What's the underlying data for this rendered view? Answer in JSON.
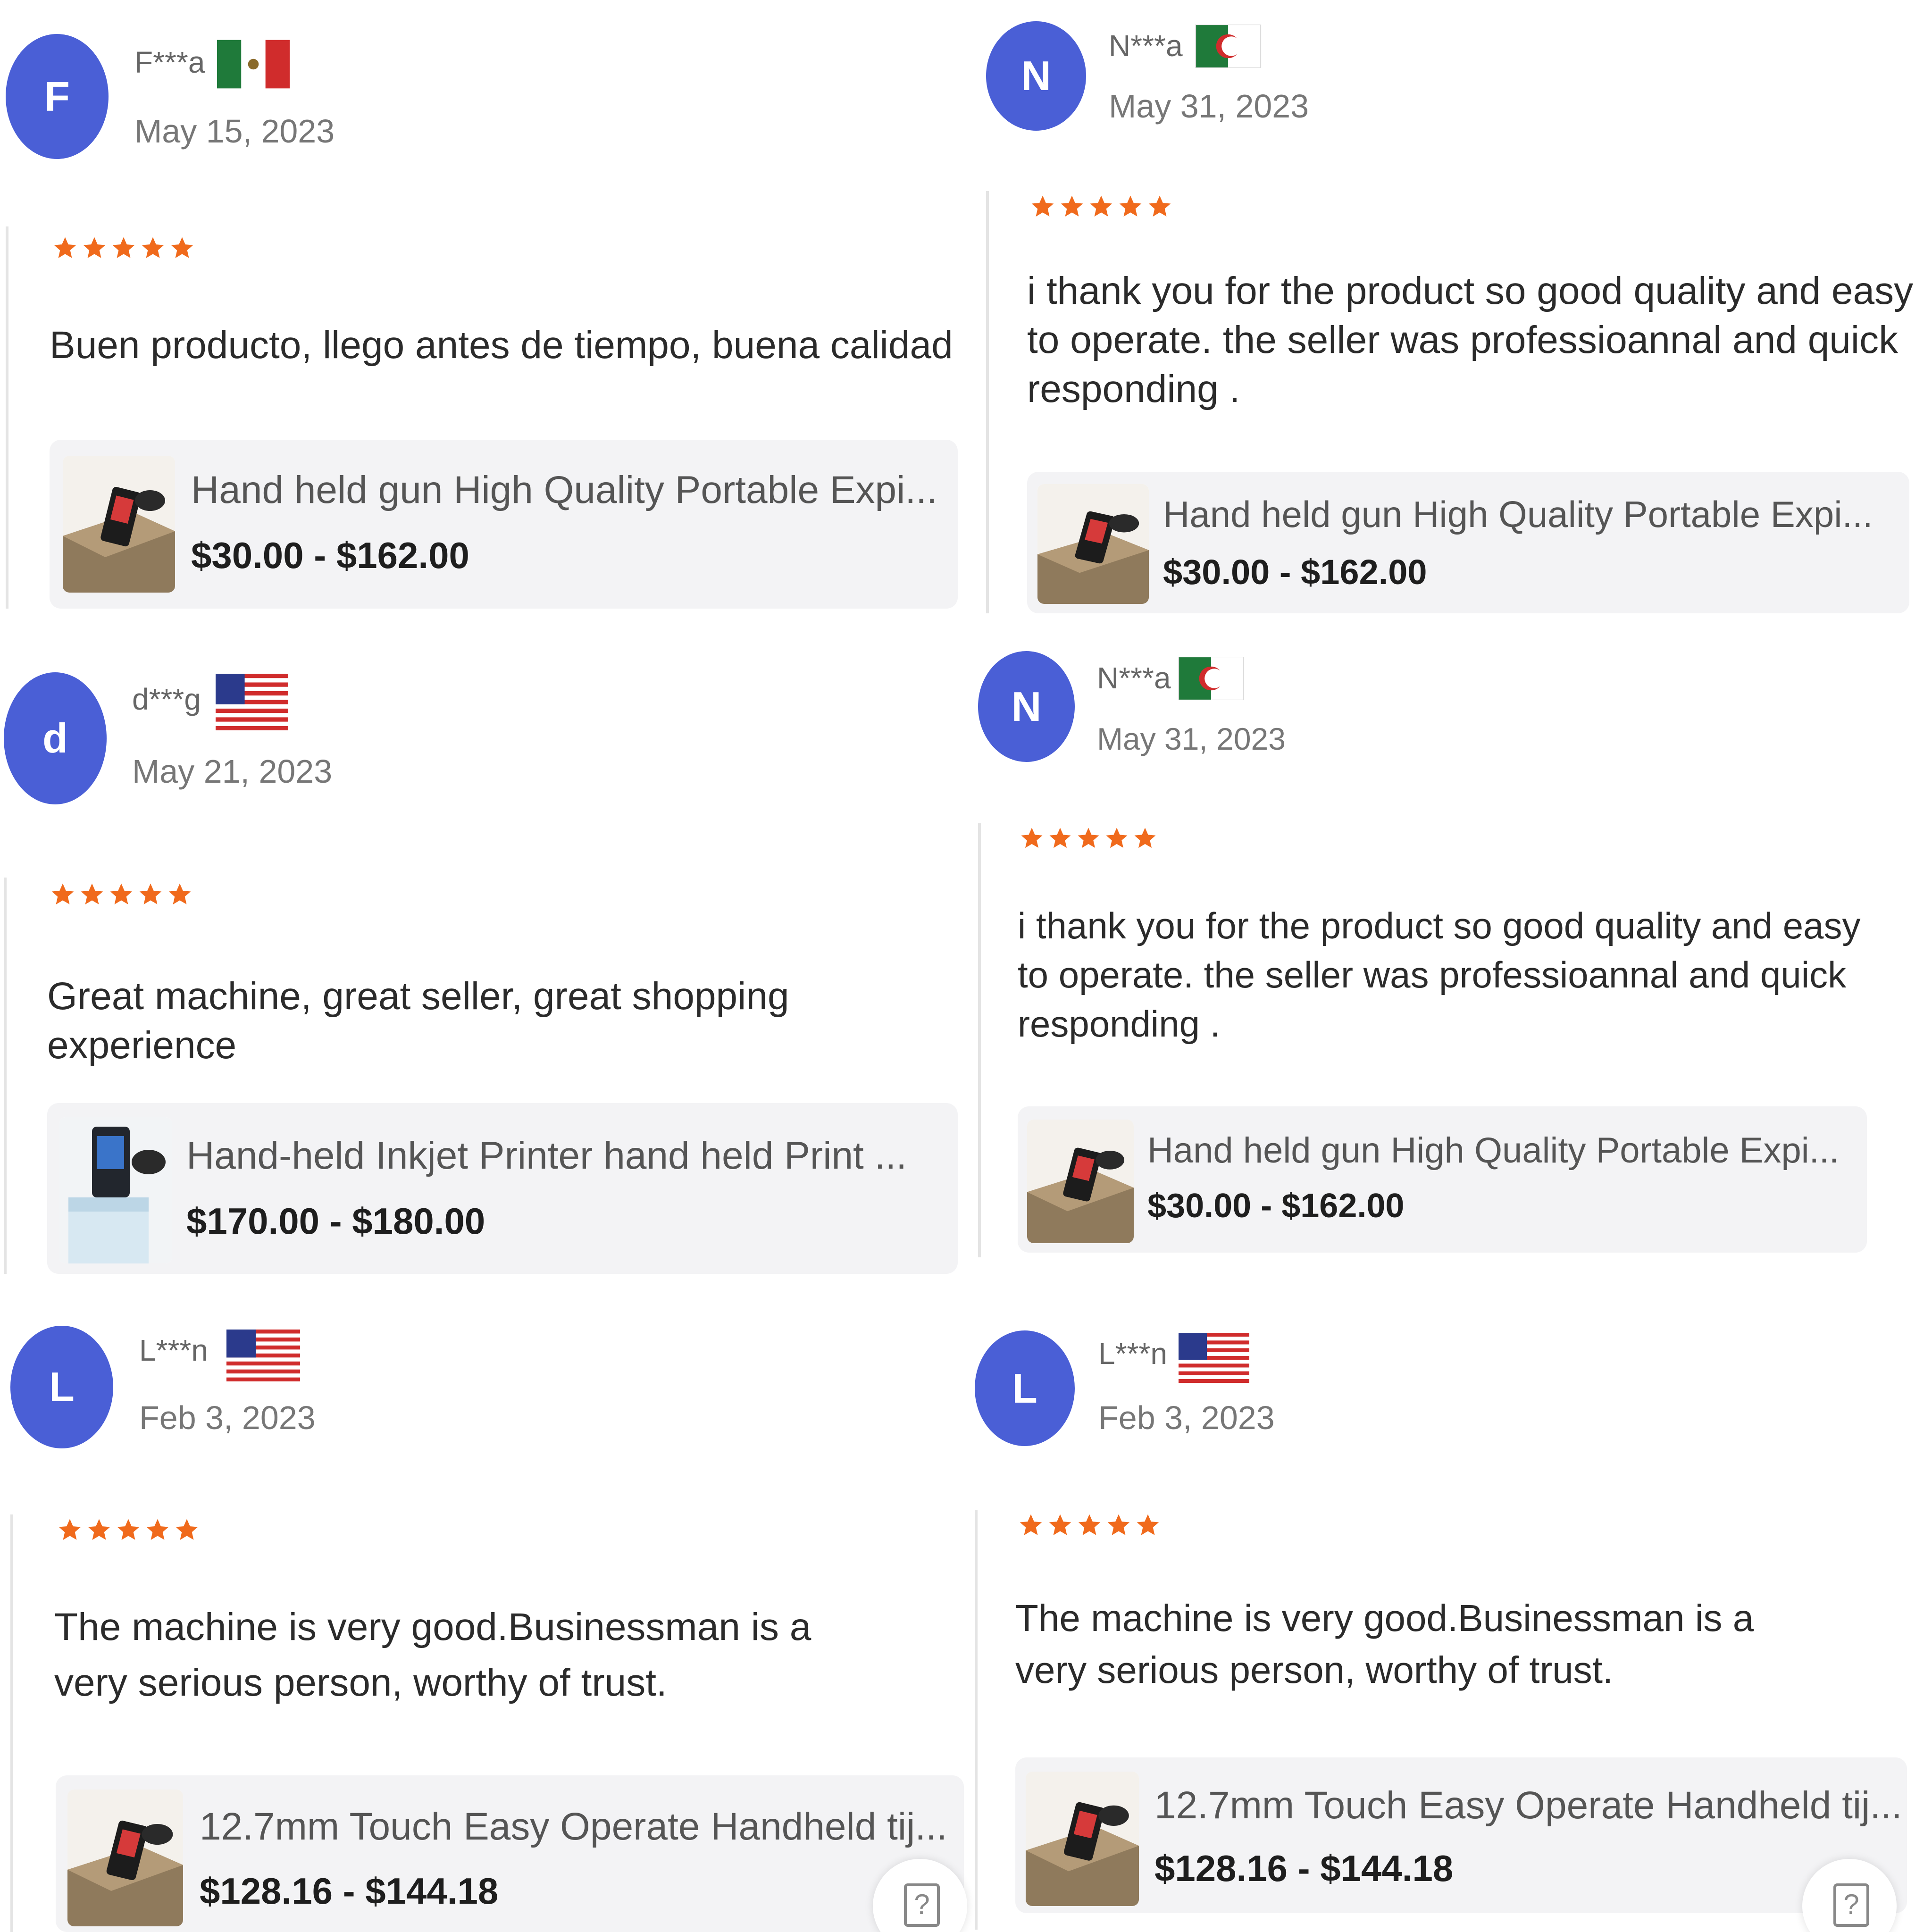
{
  "colors": {
    "avatar_bg": "#4a5fd6",
    "star": "#f06a1c",
    "card_bg": "#f3f3f5",
    "divider": "#e4e4e4"
  },
  "reviews": [
    {
      "avatar_letter": "F",
      "username": "F***a",
      "flag": "mexico-flag",
      "date": "May 15, 2023",
      "rating": 5,
      "text": "Buen producto, llego antes de tiempo, buena calidad",
      "product": {
        "title": "Hand held gun High Quality Portable Expi...",
        "price": "$30.00 - $162.00",
        "thumb": "handheld-printer-on-box-image"
      }
    },
    {
      "avatar_letter": "N",
      "username": "N***a",
      "flag": "algeria-flag",
      "date": "May 31, 2023",
      "rating": 5,
      "text": "i thank you for the product so good quality and easy to operate. the seller was professioannal and quick responding .",
      "product": {
        "title": "Hand held gun High Quality Portable Expi...",
        "price": "$30.00 - $162.00",
        "thumb": "handheld-printer-on-box-image"
      }
    },
    {
      "avatar_letter": "d",
      "username": "d***g",
      "flag": "usa-flag",
      "date": "May 21, 2023",
      "rating": 5,
      "text": "Great machine, great seller, great shopping experience",
      "product": {
        "title": "Hand-held Inkjet Printer hand held Print ...",
        "price": "$170.00 - $180.00",
        "thumb": "inkjet-printer-image"
      }
    },
    {
      "avatar_letter": "N",
      "username": "N***a",
      "flag": "algeria-flag",
      "date": "May 31, 2023",
      "rating": 5,
      "text": "i thank you for the product so good quality and easy to operate. the seller was professioannal and quick responding .",
      "product": {
        "title": "Hand held gun High Quality Portable Expi...",
        "price": "$30.00 - $162.00",
        "thumb": "handheld-printer-on-box-image"
      }
    },
    {
      "avatar_letter": "L",
      "username": "L***n",
      "flag": "usa-flag",
      "date": "Feb 3, 2023",
      "rating": 5,
      "text": "The machine is very good.Businessman is a very serious person, worthy of trust.",
      "product": {
        "title": "12.7mm Touch Easy Operate Handheld tij...",
        "price": "$128.16 - $144.18",
        "thumb": "handheld-printer-on-box-image"
      }
    },
    {
      "avatar_letter": "L",
      "username": "L***n",
      "flag": "usa-flag",
      "date": "Feb 3, 2023",
      "rating": 5,
      "text": "The machine is very good.Businessman is a very serious person, worthy of trust.",
      "product": {
        "title": "12.7mm Touch Easy Operate Handheld tij...",
        "price": "$128.16 - $144.18",
        "thumb": "handheld-printer-on-box-image"
      }
    }
  ]
}
